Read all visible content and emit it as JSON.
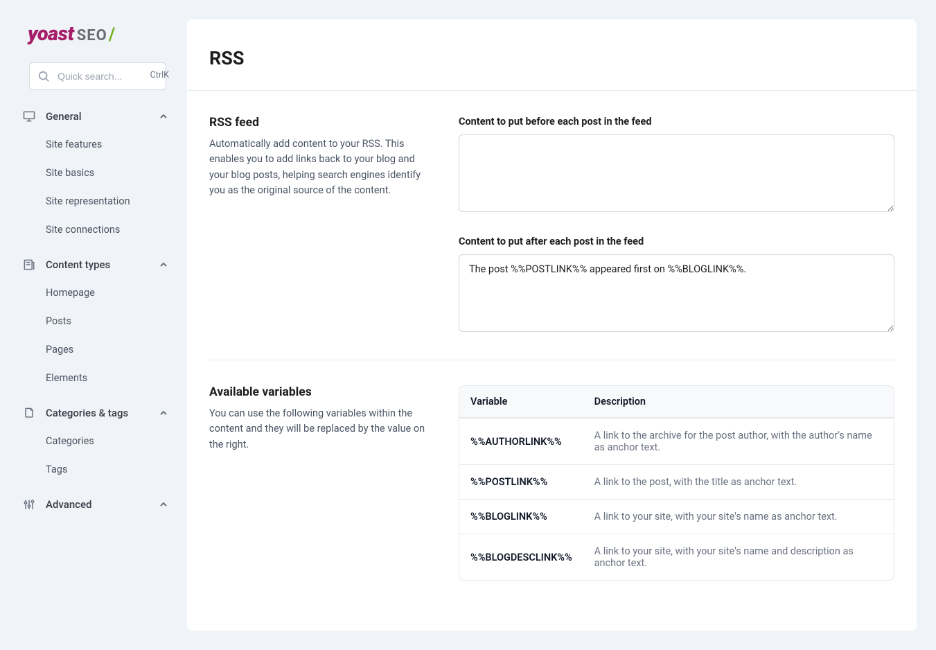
{
  "logo": {
    "brand": "yoast",
    "suffix": "SEO",
    "slash": "/"
  },
  "search": {
    "placeholder": "Quick search...",
    "shortcut": "CtrlK"
  },
  "nav": {
    "sections": [
      {
        "title": "General",
        "items": [
          {
            "label": "Site features"
          },
          {
            "label": "Site basics"
          },
          {
            "label": "Site representation"
          },
          {
            "label": "Site connections"
          }
        ]
      },
      {
        "title": "Content types",
        "items": [
          {
            "label": "Homepage"
          },
          {
            "label": "Posts"
          },
          {
            "label": "Pages"
          },
          {
            "label": "Elements"
          }
        ]
      },
      {
        "title": "Categories & tags",
        "items": [
          {
            "label": "Categories"
          },
          {
            "label": "Tags"
          }
        ]
      },
      {
        "title": "Advanced",
        "items": []
      }
    ]
  },
  "page": {
    "title": "RSS",
    "rss_feed": {
      "heading": "RSS feed",
      "description": "Automatically add content to your RSS. This enables you to add links back to your blog and your blog posts, helping search engines identify you as the original source of the content.",
      "before_label": "Content to put before each post in the feed",
      "before_value": "",
      "after_label": "Content to put after each post in the feed",
      "after_value": "The post %%POSTLINK%% appeared first on %%BLOGLINK%%."
    },
    "variables": {
      "heading": "Available variables",
      "description": "You can use the following variables within the content and they will be replaced by the value on the right.",
      "columns": {
        "variable": "Variable",
        "description": "Description"
      },
      "rows": [
        {
          "name": "%%AUTHORLINK%%",
          "desc": "A link to the archive for the post author, with the author's name as anchor text."
        },
        {
          "name": "%%POSTLINK%%",
          "desc": "A link to the post, with the title as anchor text."
        },
        {
          "name": "%%BLOGLINK%%",
          "desc": "A link to your site, with your site's name as anchor text."
        },
        {
          "name": "%%BLOGDESCLINK%%",
          "desc": "A link to your site, with your site's name and description as anchor text."
        }
      ]
    }
  }
}
